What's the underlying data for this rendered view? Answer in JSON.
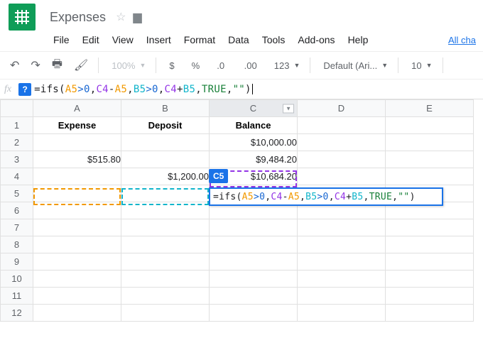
{
  "header": {
    "doc_title": "Expenses",
    "menus": [
      "File",
      "Edit",
      "View",
      "Insert",
      "Format",
      "Data",
      "Tools",
      "Add-ons",
      "Help"
    ],
    "right_link": "All cha"
  },
  "toolbar": {
    "zoom": "100%",
    "number_format_label": "123",
    "font": "Default (Ari...",
    "font_size": "10"
  },
  "formula": {
    "eq": "=",
    "fn": "ifs",
    "open": "(",
    "a5": "A5",
    "gt0a": ">0",
    "comma": ",",
    "c4a": "C4",
    "minus": "-",
    "a5b": "A5",
    "b5": "B5",
    "gt0b": ">0",
    "c4b": "C4",
    "plus": "+",
    "b5b": "B5",
    "tru": "TRUE",
    "str": "\"\"",
    "close": ")"
  },
  "grid": {
    "columns": [
      "A",
      "B",
      "C",
      "D",
      "E"
    ],
    "active_col": "C",
    "rows": [
      "1",
      "2",
      "3",
      "4",
      "5",
      "6",
      "7",
      "8",
      "9",
      "10",
      "11",
      "12"
    ],
    "headers": {
      "A": "Expense",
      "B": "Deposit",
      "C": "Balance"
    },
    "data": {
      "C2": "$10,000.00",
      "A3": "$515.80",
      "C3": "$9,484.20",
      "B4": "$1,200.00",
      "C4": "$10,684.20"
    },
    "editing_cell_label": "C5"
  }
}
